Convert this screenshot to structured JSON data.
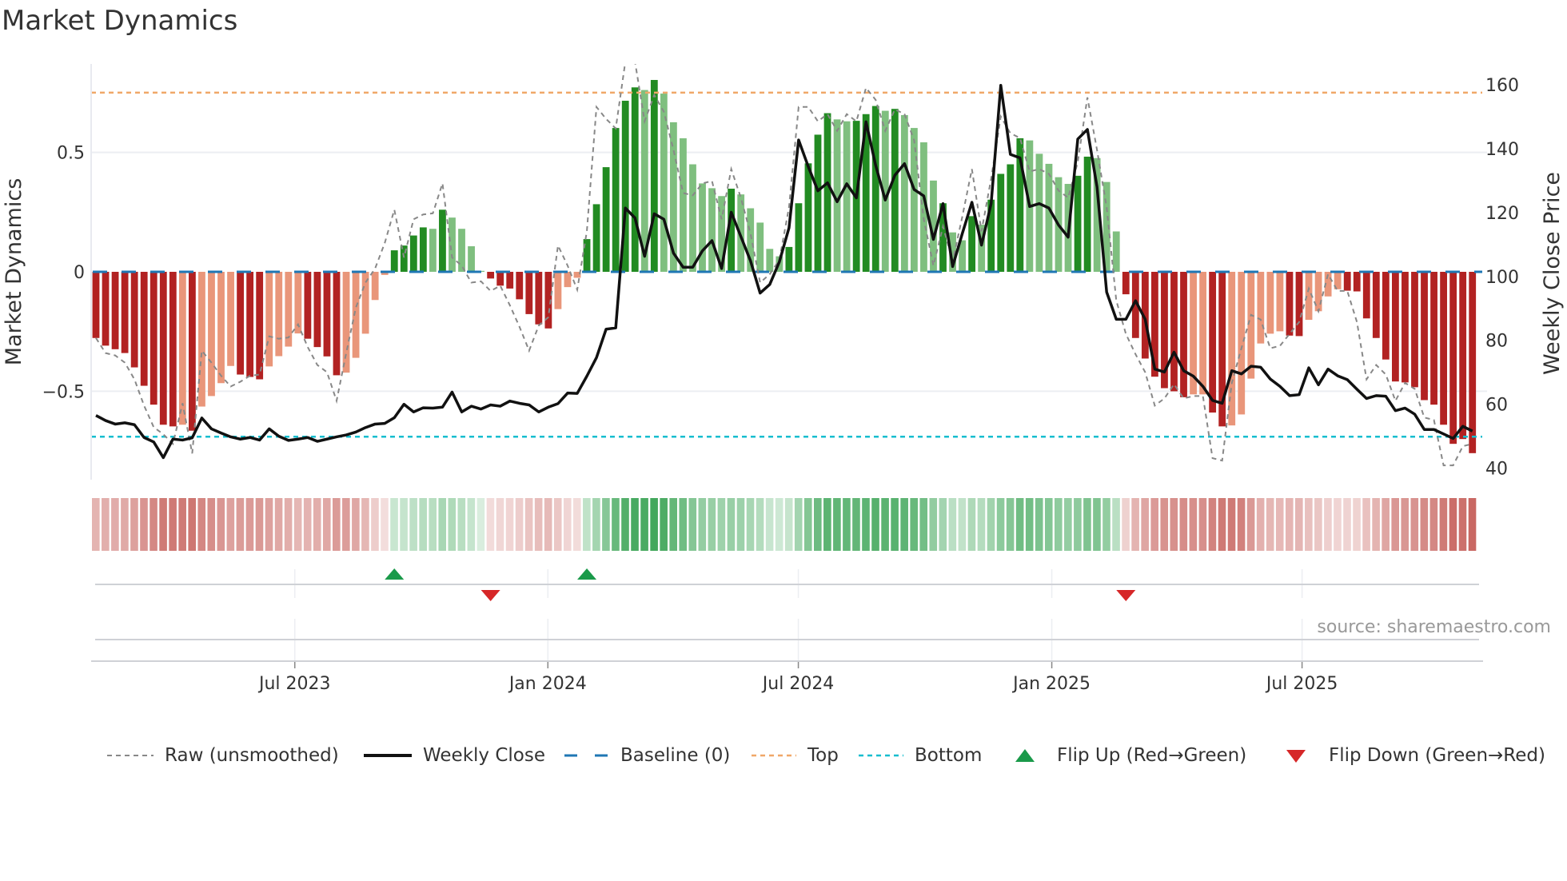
{
  "title": "Market Dynamics",
  "source": "source: sharemaestro.com",
  "chart_data": {
    "type": "bar",
    "title": "Market Dynamics",
    "ylabel_left": "Market Dynamics",
    "ylabel_right": "Weekly Close Price",
    "ylim_left": [
      -0.87,
      0.87
    ],
    "ylim_right": [
      36.4,
      166.5
    ],
    "left_ticks": [
      {
        "value": 0.5,
        "label": "0.5"
      },
      {
        "value": 0,
        "label": "0"
      },
      {
        "value": -0.5,
        "label": "−0.5"
      }
    ],
    "right_ticks": [
      {
        "value": 160,
        "label": "160"
      },
      {
        "value": 140,
        "label": "140"
      },
      {
        "value": 120,
        "label": "120"
      },
      {
        "value": 100,
        "label": "100"
      },
      {
        "value": 80,
        "label": "80"
      },
      {
        "value": 60,
        "label": "60"
      },
      {
        "value": 40,
        "label": "40"
      }
    ],
    "x_unit": "week index",
    "x_ticks": [
      {
        "label": "Jul 2023",
        "week": 20.66
      },
      {
        "label": "Jan 2024",
        "week": 46.95
      },
      {
        "label": "Jul 2024",
        "week": 72.97
      },
      {
        "label": "Jan 2025",
        "week": 99.3
      },
      {
        "label": "Jul 2025",
        "week": 125.3
      }
    ],
    "grid": true,
    "thresholds": {
      "top": 0.75,
      "bottom": -0.69,
      "baseline": 0
    },
    "momentum": [
      -0.277,
      -0.309,
      -0.324,
      -0.34,
      -0.4,
      -0.477,
      -0.556,
      -0.64,
      -0.647,
      -0.64,
      -0.665,
      -0.564,
      -0.52,
      -0.466,
      -0.394,
      -0.43,
      -0.44,
      -0.45,
      -0.396,
      -0.353,
      -0.313,
      -0.258,
      -0.28,
      -0.315,
      -0.354,
      -0.433,
      -0.422,
      -0.36,
      -0.259,
      -0.118,
      -0.013,
      0.09,
      0.11,
      0.152,
      0.186,
      0.18,
      0.26,
      0.227,
      0.18,
      0.107,
      0.004,
      -0.028,
      -0.058,
      -0.07,
      -0.115,
      -0.177,
      -0.22,
      -0.237,
      -0.156,
      -0.064,
      -0.025,
      0.137,
      0.283,
      0.438,
      0.602,
      0.716,
      0.772,
      0.761,
      0.803,
      0.746,
      0.626,
      0.559,
      0.45,
      0.37,
      0.35,
      0.317,
      0.348,
      0.324,
      0.266,
      0.206,
      0.096,
      0.065,
      0.104,
      0.287,
      0.454,
      0.574,
      0.664,
      0.638,
      0.63,
      0.632,
      0.66,
      0.694,
      0.674,
      0.682,
      0.656,
      0.602,
      0.542,
      0.382,
      0.287,
      0.165,
      0.132,
      0.233,
      0.197,
      0.302,
      0.41,
      0.45,
      0.559,
      0.55,
      0.494,
      0.452,
      0.396,
      0.368,
      0.402,
      0.482,
      0.476,
      0.376,
      0.169,
      -0.094,
      -0.277,
      -0.363,
      -0.439,
      -0.487,
      -0.5,
      -0.525,
      -0.513,
      -0.513,
      -0.589,
      -0.647,
      -0.643,
      -0.597,
      -0.447,
      -0.3,
      -0.259,
      -0.249,
      -0.267,
      -0.269,
      -0.201,
      -0.165,
      -0.103,
      -0.073,
      -0.079,
      -0.082,
      -0.195,
      -0.277,
      -0.367,
      -0.459,
      -0.463,
      -0.483,
      -0.537,
      -0.556,
      -0.64,
      -0.72,
      -0.7,
      -0.759
    ],
    "bar_shade": "DDDDDDDDDLDLLLLDDDLLLLDDDDLLLLLDDDDLDLLLLDDDDDDDLLLDDDDDDLDLLLLLLLDLLLLLDDDDDLLDDDLDLLLLDLLDLDDDDLLLLLDDLLLDDDDDDDLLDDLLLLLLDDLLLLDDDDDDDDDDDDDD",
    "raw": [
      -0.277,
      -0.34,
      -0.35,
      -0.38,
      -0.45,
      -0.56,
      -0.65,
      -0.68,
      -0.72,
      -0.55,
      -0.76,
      -0.33,
      -0.38,
      -0.435,
      -0.48,
      -0.46,
      -0.435,
      -0.43,
      -0.27,
      -0.28,
      -0.275,
      -0.22,
      -0.315,
      -0.39,
      -0.42,
      -0.54,
      -0.34,
      -0.15,
      -0.045,
      0.014,
      0.12,
      0.26,
      0.06,
      0.22,
      0.24,
      0.245,
      0.37,
      0.06,
      0.026,
      -0.045,
      -0.04,
      -0.08,
      -0.058,
      -0.14,
      -0.23,
      -0.33,
      -0.225,
      -0.19,
      0.11,
      0.026,
      -0.075,
      0.17,
      0.69,
      0.64,
      0.6,
      0.88,
      0.88,
      0.63,
      0.74,
      0.67,
      0.51,
      0.33,
      0.32,
      0.37,
      0.38,
      0.22,
      0.43,
      0.31,
      0.16,
      -0.045,
      -0.01,
      0.05,
      0.27,
      0.69,
      0.69,
      0.63,
      0.66,
      0.59,
      0.66,
      0.63,
      0.77,
      0.72,
      0.59,
      0.68,
      0.66,
      0.55,
      0.22,
      0.026,
      0.19,
      0.044,
      0.23,
      0.43,
      0.17,
      0.39,
      0.65,
      0.58,
      0.56,
      0.42,
      0.43,
      0.41,
      0.34,
      0.31,
      0.46,
      0.73,
      0.51,
      0.27,
      -0.12,
      -0.26,
      -0.345,
      -0.42,
      -0.56,
      -0.53,
      -0.47,
      -0.53,
      -0.52,
      -0.52,
      -0.78,
      -0.79,
      -0.465,
      -0.32,
      -0.18,
      -0.2,
      -0.32,
      -0.31,
      -0.26,
      -0.21,
      -0.07,
      -0.165,
      -0.01,
      -0.08,
      -0.08,
      -0.21,
      -0.45,
      -0.39,
      -0.43,
      -0.54,
      -0.465,
      -0.49,
      -0.61,
      -0.62,
      -0.81,
      -0.81,
      -0.73,
      -0.72
    ],
    "close": [
      56.5,
      54.9,
      53.8,
      54.2,
      53.6,
      49.6,
      48.2,
      43.3,
      49.1,
      48.8,
      49.5,
      55.7,
      52.3,
      51,
      49.8,
      49.1,
      49.6,
      48.8,
      52.3,
      50,
      48.7,
      49.1,
      49.6,
      48.4,
      49.1,
      49.8,
      50.4,
      51.3,
      52.7,
      53.8,
      54,
      55.8,
      60,
      57.6,
      58.9,
      58.8,
      59.1,
      63.8,
      57.6,
      59.4,
      58.5,
      59.8,
      59.4,
      61,
      60.3,
      59.8,
      57.6,
      59.1,
      60.2,
      63.5,
      63.4,
      68.8,
      74.6,
      83.5,
      83.9,
      121.4,
      118.3,
      106.3,
      119.6,
      117.9,
      107.3,
      102.9,
      102.9,
      108,
      111.2,
      102.5,
      120.1,
      112.5,
      104.9,
      94.8,
      97.5,
      104.6,
      115.2,
      142.7,
      134.4,
      126.8,
      129.3,
      123.4,
      129,
      124.6,
      148.4,
      134.8,
      123.9,
      131.7,
      135.3,
      127.2,
      125.2,
      111.6,
      122.8,
      103.1,
      113.4,
      123.2,
      109.8,
      122.8,
      159.8,
      138.2,
      137.1,
      121.9,
      122.8,
      121.4,
      116.1,
      112.3,
      143,
      146,
      128,
      95.1,
      86.6,
      86.6,
      92.4,
      86.6,
      71,
      70.1,
      76.3,
      70.5,
      68.8,
      65.6,
      61.2,
      60.3,
      70.5,
      69.5,
      71.9,
      71.6,
      67.9,
      65.6,
      62.7,
      63,
      71.4,
      66.1,
      71,
      68.9,
      67.7,
      64.7,
      61.8,
      62.7,
      62.5,
      58,
      58.8,
      56.9,
      52.1,
      52.1,
      50.7,
      49.3,
      53.1,
      51.6
    ],
    "flips": [
      {
        "week": 31,
        "type": "up"
      },
      {
        "week": 41,
        "type": "down"
      },
      {
        "week": 51,
        "type": "up"
      },
      {
        "week": 107,
        "type": "down"
      }
    ],
    "legend_position": "bottom",
    "legend": [
      {
        "label": "Raw (unsmoothed)",
        "key": "raw"
      },
      {
        "label": "Weekly Close",
        "key": "close"
      },
      {
        "label": "Baseline (0)",
        "key": "baseline"
      },
      {
        "label": "Top",
        "key": "top"
      },
      {
        "label": "Bottom",
        "key": "bottom"
      },
      {
        "label": "Flip Up (Red→Green)",
        "key": "flip_up"
      },
      {
        "label": "Flip Down (Green→Red)",
        "key": "flip_down"
      }
    ],
    "colors": {
      "bar_red_dark": "#b22222",
      "bar_red_light": "#e9967a",
      "bar_green_dark": "#228b22",
      "bar_green_light": "#7fbf7f",
      "heat_red": "#c0504a",
      "heat_green": "#2e9e4a",
      "raw": "#888888",
      "close": "#111111",
      "baseline": "#1f77b4",
      "top": "#f0a868",
      "bottom": "#17becf",
      "flip_up": "#1a9a4a",
      "flip_down": "#d62728"
    }
  }
}
